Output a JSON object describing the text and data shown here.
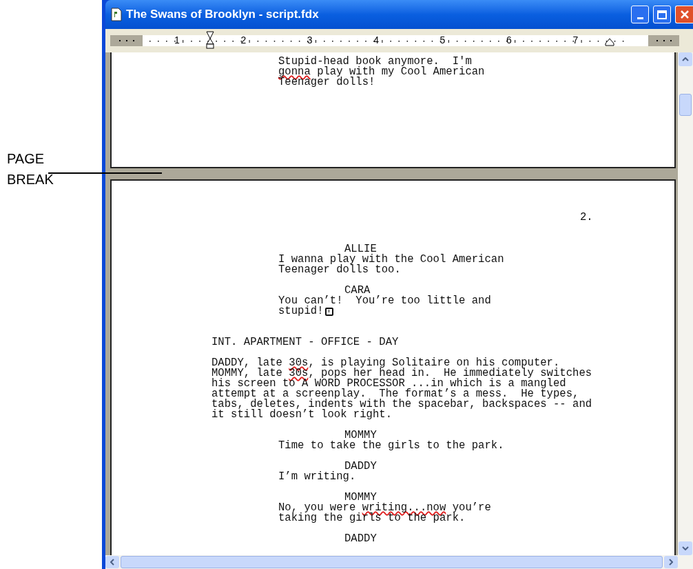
{
  "callout": {
    "lines": [
      "PAGE",
      "BREAK"
    ]
  },
  "window": {
    "title": "The Swans of Brooklyn - script.fdx"
  },
  "ruler": {
    "numbers": [
      "1",
      "2",
      "3",
      "4",
      "5",
      "6",
      "7"
    ]
  },
  "pages": [
    {
      "paragraphs": [
        {
          "kind": "dialogue",
          "has_note": false,
          "segments": [
            {
              "text": "Stupid-head book anymore.  I'm\n",
              "misspelled": false
            },
            {
              "text": "gonna",
              "misspelled": true
            },
            {
              "text": " play with my Cool American\nTeenager dolls!",
              "misspelled": false
            }
          ]
        }
      ]
    },
    {
      "page_number": "2.",
      "paragraphs": [
        {
          "kind": "character",
          "has_note": false,
          "text": "ALLIE"
        },
        {
          "kind": "dialogue",
          "has_note": false,
          "text": "I wanna play with the Cool American\nTeenager dolls too."
        },
        {
          "kind": "character",
          "has_note": false,
          "text": "CARA"
        },
        {
          "kind": "dialogue",
          "has_note": true,
          "text": "You can’t!  You’re too little and\nstupid!"
        },
        {
          "kind": "scene",
          "has_note": false,
          "text": "INT. APARTMENT - OFFICE - DAY"
        },
        {
          "kind": "action",
          "has_note": false,
          "segments": [
            {
              "text": "DADDY, late ",
              "misspelled": false
            },
            {
              "text": "30s",
              "misspelled": true
            },
            {
              "text": ", is playing Solitaire on his computer.\nMOMMY, late ",
              "misspelled": false
            },
            {
              "text": "30s",
              "misspelled": true
            },
            {
              "text": ", pops her head in.  He immediately switches\nhis screen to A WORD PROCESSOR ...in which is a mangled\nattempt at a screenplay.  The format’s a mess.  He types,\ntabs, deletes, indents with the spacebar, backspaces -- and\nit still doesn’t look right.",
              "misspelled": false
            }
          ]
        },
        {
          "kind": "character",
          "has_note": false,
          "text": "MOMMY"
        },
        {
          "kind": "dialogue",
          "has_note": false,
          "text": "Time to take the girls to the park."
        },
        {
          "kind": "character",
          "has_note": false,
          "text": "DADDY"
        },
        {
          "kind": "dialogue",
          "has_note": false,
          "text": "I’m writing."
        },
        {
          "kind": "character",
          "has_note": false,
          "text": "MOMMY"
        },
        {
          "kind": "dialogue",
          "has_note": false,
          "segments": [
            {
              "text": "No, you were ",
              "misspelled": false
            },
            {
              "text": "writing...now",
              "misspelled": true
            },
            {
              "text": " you’re\ntaking the girls to the park.",
              "misspelled": false
            }
          ]
        },
        {
          "kind": "character",
          "has_note": false,
          "text": "DADDY"
        }
      ]
    }
  ]
}
